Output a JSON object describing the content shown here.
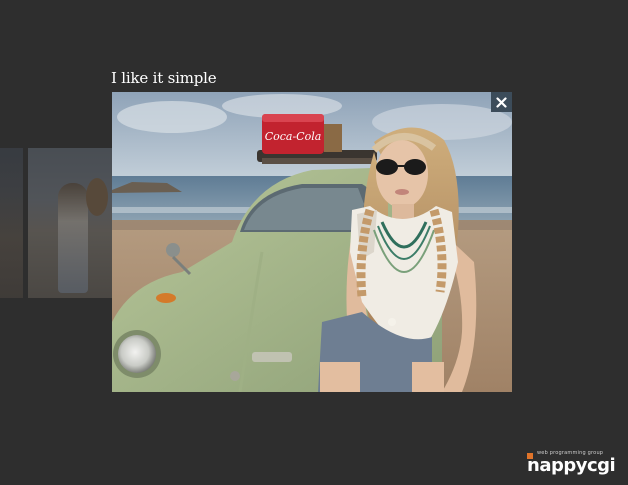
{
  "lightbox": {
    "caption": "I like it simple",
    "close_icon": "close-icon",
    "photo_subject": ""
  },
  "background_gallery": {
    "thumbnails": 2
  },
  "brand": {
    "logo_word": "nappycgi",
    "logo_tagline": "web programming group",
    "accent_color": "#e0742a"
  },
  "colors": {
    "page_background": "#2e2e2e",
    "close_button": "#3c4c5a"
  }
}
